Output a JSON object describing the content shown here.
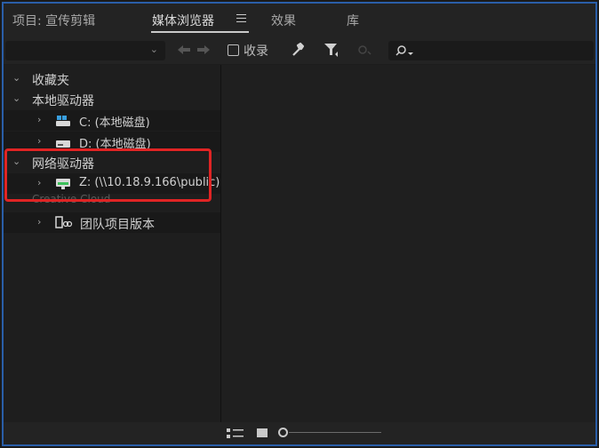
{
  "tabs": {
    "project": "项目: 宣传剪辑",
    "media_browser": "媒体浏览器",
    "effects": "效果",
    "library": "库"
  },
  "toolbar": {
    "favorites_checkbox_label": "收录",
    "search_placeholder": ""
  },
  "tree": {
    "favorites": "收藏夹",
    "local_drives": "本地驱动器",
    "drive_c": "C: (本地磁盘)",
    "drive_d": "D: (本地磁盘)",
    "network_drives": "网络驱动器",
    "drive_z": "Z: (\\\\10.18.9.166\\public)",
    "creative_cloud": "Creative Cloud",
    "team_projects": "团队项目版本"
  },
  "colors": {
    "highlight": "#e02424",
    "frame_border": "#2a5ea8"
  },
  "icons": [
    "menu-icon",
    "back-arrow-icon",
    "forward-arrow-icon",
    "wrench-icon",
    "filter-icon",
    "eye-icon",
    "search-icon",
    "chevron-down-icon",
    "disk-icon",
    "network-drive-icon",
    "team-project-icon",
    "list-view-icon",
    "icon-view-icon",
    "zoom-slider"
  ]
}
